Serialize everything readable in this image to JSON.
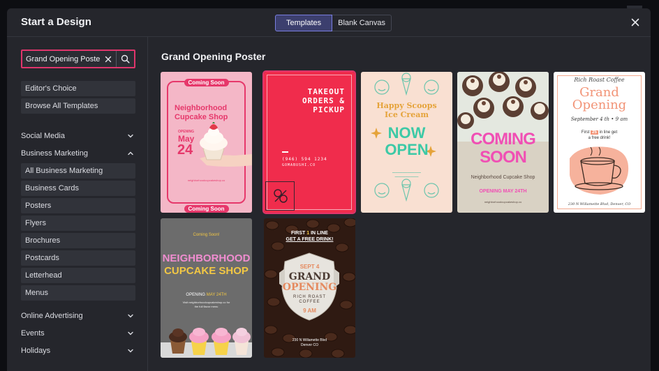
{
  "dialog": {
    "title": "Start a Design",
    "tabs": [
      "Templates",
      "Blank Canvas"
    ],
    "close_icon": "close-icon"
  },
  "search": {
    "value": "Grand Opening Poster",
    "placeholder": "Search templates"
  },
  "sidebar": {
    "quick": [
      "Editor's Choice",
      "Browse All Templates"
    ],
    "categories": [
      {
        "label": "Social Media",
        "expanded": false
      },
      {
        "label": "Business Marketing",
        "expanded": true
      },
      {
        "label": "Online Advertising",
        "expanded": false
      },
      {
        "label": "Events",
        "expanded": false
      },
      {
        "label": "Holidays",
        "expanded": false
      }
    ],
    "business_items": [
      "All Business Marketing",
      "Business Cards",
      "Posters",
      "Flyers",
      "Brochures",
      "Postcards",
      "Letterhead",
      "Menus"
    ]
  },
  "results": {
    "title": "Grand Opening Poster",
    "cards": [
      {
        "top": "Coming Soon",
        "heading": [
          "Neighborhood",
          "Cupcake Shop"
        ],
        "small": "OPENING",
        "date": [
          "May",
          "24"
        ],
        "bottom": "Coming Soon"
      },
      {
        "heading": [
          "TAKEOUT",
          "ORDERS &",
          "PICKUP"
        ],
        "phone": "(946) 594 1234",
        "site": "GOMABUSHI.CO"
      },
      {
        "heading": [
          "Happy Scoops",
          "Ice Cream"
        ],
        "big": [
          "NOW",
          "OPEN"
        ]
      },
      {
        "big": [
          "COMING",
          "SOON"
        ],
        "name": "Neighborhood Cupcake Shop",
        "date": "OPENING MAY 24TH"
      },
      {
        "brand": "Rich Roast Coffee",
        "heading": [
          "Grand",
          "Opening"
        ],
        "date": "September 4 th • 9 am",
        "offer_pre": "First",
        "offer_num": "25",
        "offer_post": "in line get",
        "offer_line2": "a free drink!",
        "address": "230 N Willamette Blvd, Denver, CO"
      },
      {
        "top": "Coming Soon!",
        "heading": [
          "NEIGHBORHOOD",
          "CUPCAKE SHOP"
        ],
        "date_pre": "OPENING",
        "date_post": "MAY 24TH",
        "url": "Visit neighborhoodcupcakeshop.co for"
      },
      {
        "top": [
          "FIRST",
          "IN LINE",
          "GET A FREE DRINK!"
        ],
        "date": "SEPT 4",
        "heading": [
          "GRAND",
          "OPENING"
        ],
        "brand": [
          "RICH ROAST",
          "COFFEE"
        ],
        "time": "9 AM",
        "address": [
          "230 N Willamette Blvd",
          "Denver CO"
        ]
      }
    ]
  }
}
